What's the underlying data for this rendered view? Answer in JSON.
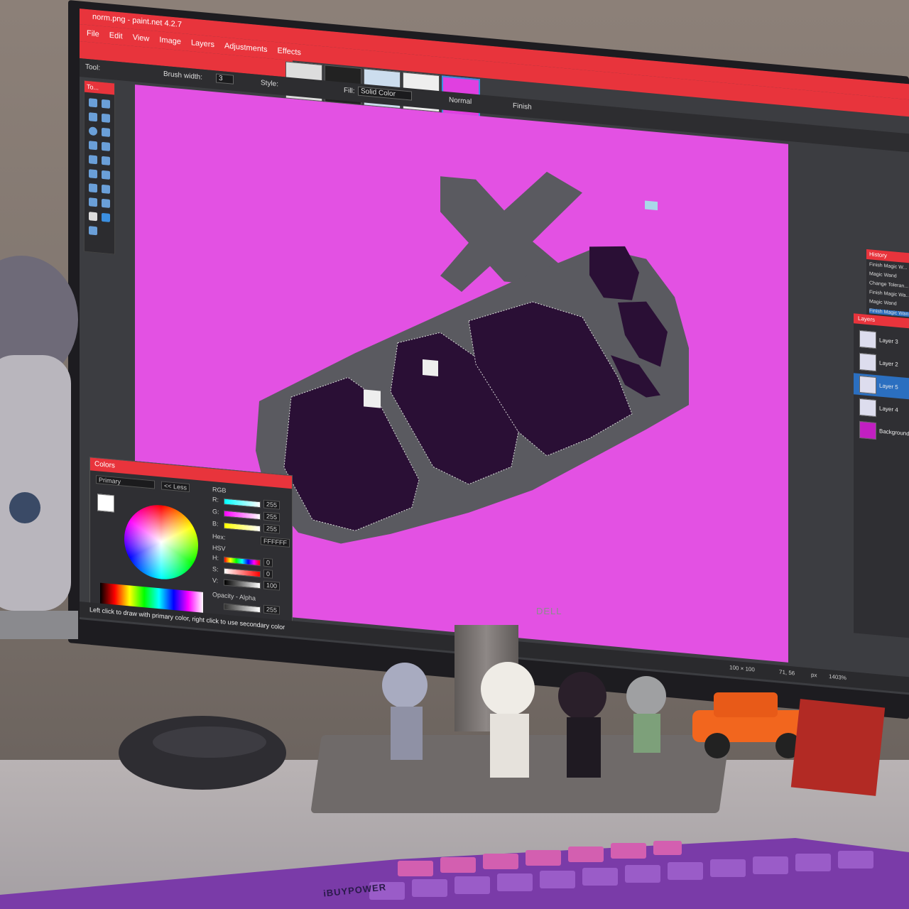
{
  "app": {
    "title": "norm.png - paint.net 4.2.7",
    "menu": [
      "File",
      "Edit",
      "View",
      "Image",
      "Layers",
      "Adjustments",
      "Effects"
    ]
  },
  "toolbar": {
    "tool_label": "Tool:",
    "brush_width_label": "Brush width:",
    "brush_width_value": "3",
    "style_label": "Style:",
    "fill_label": "Fill:",
    "fill_value": "Solid Color",
    "blend_mode": "Normal",
    "finish_label": "Finish"
  },
  "tools_panel": {
    "title": "To..."
  },
  "colors_panel": {
    "title": "Colors",
    "primary_select": "Primary",
    "less_button": "<< Less",
    "rgb_label": "RGB",
    "r_label": "R:",
    "r_value": "255",
    "g_label": "G:",
    "g_value": "255",
    "b_label": "B:",
    "b_value": "255",
    "hex_label": "Hex:",
    "hex_value": "FFFFFF",
    "hsv_label": "HSV",
    "h_label": "H:",
    "h_value": "0",
    "s_label": "S:",
    "s_value": "0",
    "v_label": "V:",
    "v_value": "100",
    "opacity_label": "Opacity - Alpha",
    "opacity_value": "255"
  },
  "history_panel": {
    "title": "History",
    "items": [
      "Finish Magic W...",
      "Magic Wand",
      "Change Toleran...",
      "Finish Magic Wa...",
      "Magic Wand",
      "Finish Magic Wan..."
    ]
  },
  "layers_panel": {
    "title": "Layers",
    "items": [
      "Layer 3",
      "Layer 2",
      "Layer 5",
      "Layer 4",
      "Background"
    ]
  },
  "status": {
    "hint": "Left click to draw with primary color, right click to use secondary color",
    "size": "100 × 100",
    "position": "71, 56",
    "unit": "px",
    "zoom": "1403%"
  },
  "monitor_brand": "DELL",
  "keyboard_brand": "iBUYPOWER",
  "colors": {
    "accent": "#e8343c",
    "canvas_bg": "#e351e3",
    "sprite_dark": "#2a0f35",
    "sprite_gray": "#5a5a60"
  }
}
